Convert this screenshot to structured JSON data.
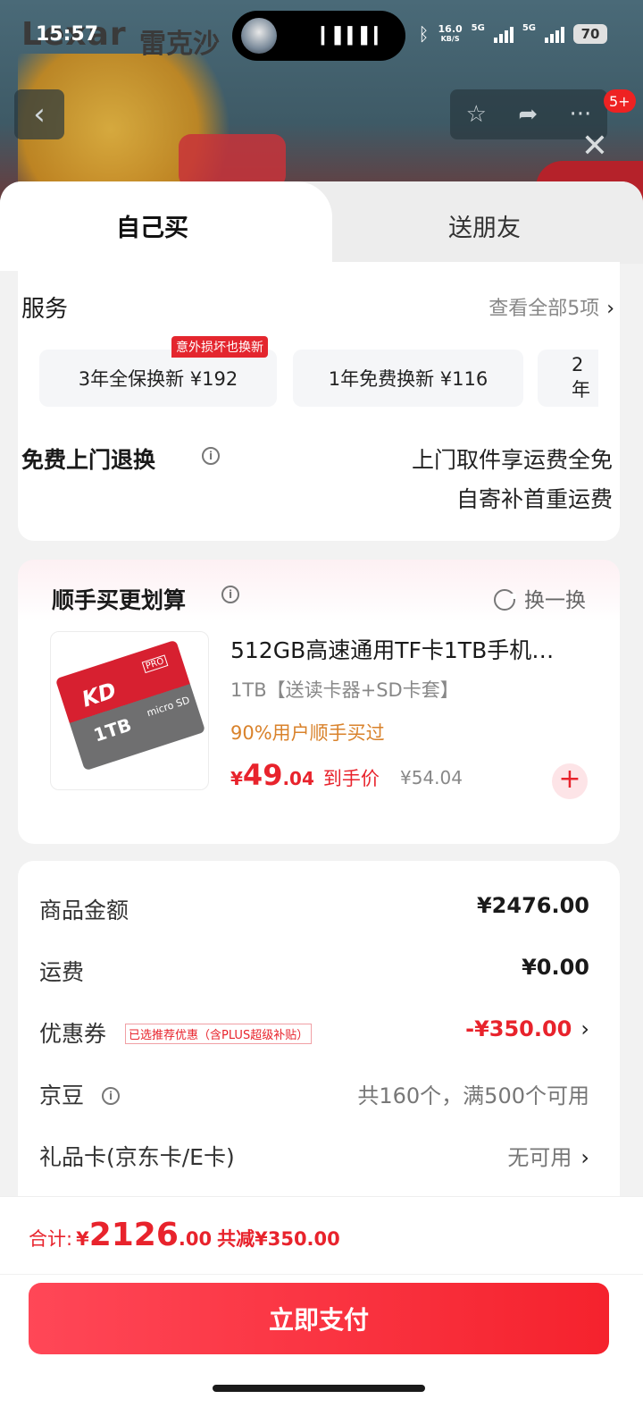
{
  "status": {
    "time": "15:57",
    "speed_top": "16.0",
    "speed_unit": "KB/S",
    "net1": "5G",
    "net2": "5G",
    "battery": "70"
  },
  "background": {
    "logo_en": "Lexar",
    "logo_cn": "雷克沙",
    "notify_badge": "5+"
  },
  "tabs": [
    {
      "label": "自己买"
    },
    {
      "label": "送朋友"
    }
  ],
  "services": {
    "title": "服务",
    "view_all": "查看全部5项",
    "chips": [
      {
        "label": "3年全保换新  ¥192",
        "badge": "意外损坏也换新"
      },
      {
        "label": "1年免费换新  ¥116"
      },
      {
        "label": "2年"
      }
    ]
  },
  "return": {
    "title": "免费上门退换",
    "line1": "上门取件享运费全免",
    "line2": "自寄补首重运费"
  },
  "upsell": {
    "title": "顺手买更划算",
    "swap": "换一换",
    "product": {
      "name": "512GB高速通用TF卡1TB手机…",
      "spec": "1TB【送读卡器+SD卡套】",
      "social": "90%用户顺手买过",
      "price_symbol": "¥",
      "price_int": "49",
      "price_dec": ".04",
      "price_tag": "到手价",
      "orig_price": "¥54.04",
      "img_brand": "KD",
      "img_pro": "PRO",
      "img_capacity": "1TB",
      "img_type": "micro SD"
    }
  },
  "summary": {
    "rows": [
      {
        "label": "商品金额",
        "value": "¥2476.00"
      },
      {
        "label": "运费",
        "value": "¥0.00"
      },
      {
        "label": "优惠券",
        "tag": "已选推荐优惠（含PLUS超级补贴）",
        "value": "-¥350.00"
      },
      {
        "label": "京豆",
        "value": "共160个，满500个可用"
      },
      {
        "label": "礼品卡(京东卡/E卡)",
        "value": "无可用"
      }
    ]
  },
  "pay": {
    "total_label": "合计:",
    "total_symbol": "¥",
    "total_int": "2126",
    "total_dec": ".00",
    "saved": "共减¥350.00",
    "button": "立即支付"
  },
  "colors": {
    "accent_red": "#e8232c",
    "orange": "#d9822b",
    "pay_gradient_start": "#ff4757",
    "pay_gradient_end": "#f5222d"
  },
  "icons": [
    "back-icon",
    "star-icon",
    "share-icon",
    "more-icon",
    "close-icon",
    "info-icon",
    "refresh-icon",
    "plus-icon",
    "chevron-right-icon"
  ]
}
